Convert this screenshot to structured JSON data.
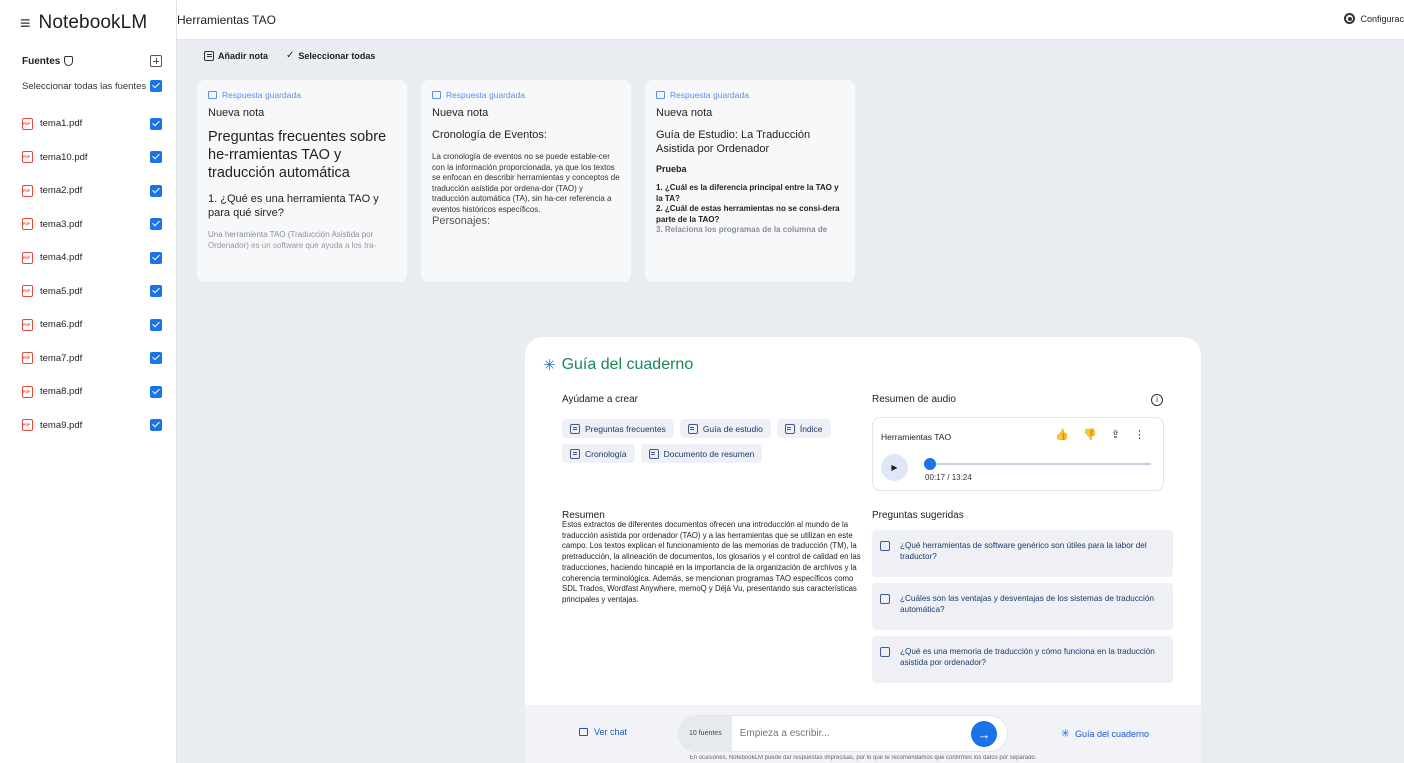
{
  "app": {
    "name": "NotebookLM",
    "menu_glyph": "≡"
  },
  "sidebar": {
    "sources_label": "Fuentes",
    "select_all_label": "Seleccionar todas las fuentes",
    "sources": [
      {
        "name": "tema1.pdf"
      },
      {
        "name": "tema10.pdf"
      },
      {
        "name": "tema2.pdf"
      },
      {
        "name": "tema3.pdf"
      },
      {
        "name": "tema4.pdf"
      },
      {
        "name": "tema5.pdf"
      },
      {
        "name": "tema6.pdf"
      },
      {
        "name": "tema7.pdf"
      },
      {
        "name": "tema8.pdf"
      },
      {
        "name": "tema9.pdf"
      }
    ]
  },
  "header": {
    "title": "Herramientas TAO",
    "config_label": "Configurac"
  },
  "toolbar": {
    "add_note": "Añadir nota",
    "select_all": "Seleccionar todas"
  },
  "notes": [
    {
      "saved": "Respuesta guardada",
      "title": "Nueva nota",
      "heading": "Preguntas frecuentes sobre he-rramientas TAO y traducción automática",
      "question": "1. ¿Qué es una herramienta TAO y para qué sirve?",
      "preview": "Una herramienta TAO (Traducción Asistida por Ordenador) es un software que ayuda a los tra-"
    },
    {
      "saved": "Respuesta guardada",
      "title": "Nueva nota",
      "heading": "Cronología de Eventos:",
      "body": "La cronología de eventos no se puede estable-cer con la información proporcionada, ya que los textos se enfocan en describir herramientas y conceptos de traducción asistida por ordena-dor (TAO) y traducción automática (TA), sin ha-cer referencia a eventos históricos específicos.",
      "tail": "Personajes:"
    },
    {
      "saved": "Respuesta guardada",
      "title": "Nueva nota",
      "heading": "Guía de Estudio: La Traducción Asistida por Ordenador",
      "subheading": "Prueba",
      "q1": "1. ¿Cuál es la diferencia principal entre la TAO y la TA?",
      "q2": "2. ¿Cuál de estas herramientas no se consi-dera parte de la TAO?",
      "q3": "3. Relaciona los programas de la columna de"
    }
  ],
  "guide": {
    "title": "Guía del cuaderno",
    "help_label": "Ayúdame a crear",
    "chips": [
      "Preguntas frecuentes",
      "Guía de estudio",
      "Índice",
      "Cronología",
      "Documento de resumen"
    ],
    "summary_label": "Resumen",
    "summary_text": "Estos extractos de diferentes documentos ofrecen una introducción al mundo de la traducción asistida por ordenador (TAO) y a las herramientas que se utilizan en este campo. Los textos explican el funcionamiento de las memorias de traducción (TM), la pretraducción, la alineación de documentos, los glosarios y el control de calidad en las traducciones, haciendo hincapié en la importancia de la organización de archivos y la coherencia terminológica. Además, se mencionan programas TAO específicos como SDL Trados, Wordfast Anywhere, memoQ y Déjà Vu, presentando sus características principales y ventajas.",
    "audio_label": "Resumen de audio",
    "audio": {
      "title": "Herramientas TAO",
      "time": "00:17 / 13:24",
      "progress": 0.021
    },
    "suggested_label": "Preguntas sugeridas",
    "suggested": [
      "¿Qué herramientas de software genérico son útiles para la labor del traductor?",
      "¿Cuáles son las ventajas y desventajas de los sistemas de traducción automática?",
      "¿Qué es una memoria de traducción y cómo funciona en la traducción asistida por ordenador?"
    ]
  },
  "chat": {
    "view_chat": "Ver chat",
    "sources_count": "10 fuentes",
    "placeholder": "Empieza a escribir...",
    "guide_button": "Guía del cuaderno",
    "disclaimer": "En ocasiones, NotebookLM puede dar respuestas imprecisas, por lo que te recomendamos que confirmes los datos por separado."
  },
  "colors": {
    "accent": "#1a73e8",
    "guide_title": "#1a8754",
    "pdf_icon": "#e5483b"
  }
}
